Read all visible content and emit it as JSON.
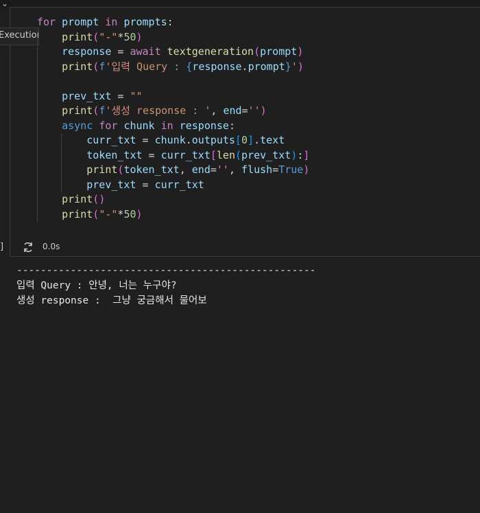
{
  "cell": {
    "exec_tab_label": "Execution",
    "code_lines": [
      [
        {
          "t": "for",
          "c": "ctl"
        },
        {
          "t": " "
        },
        {
          "t": "prompt",
          "c": "var"
        },
        {
          "t": " "
        },
        {
          "t": "in",
          "c": "ctl"
        },
        {
          "t": " "
        },
        {
          "t": "prompts",
          "c": "var"
        },
        {
          "t": ":"
        }
      ],
      [
        {
          "t": "    "
        },
        {
          "t": "print",
          "c": "fn"
        },
        {
          "t": "(",
          "c": "br2"
        },
        {
          "t": "\"-\"",
          "c": "str"
        },
        {
          "t": "*"
        },
        {
          "t": "50",
          "c": "num"
        },
        {
          "t": ")",
          "c": "br2"
        }
      ],
      [
        {
          "t": "    "
        },
        {
          "t": "response",
          "c": "var"
        },
        {
          "t": " = "
        },
        {
          "t": "await",
          "c": "ctl"
        },
        {
          "t": " "
        },
        {
          "t": "textgeneration",
          "c": "fn"
        },
        {
          "t": "(",
          "c": "br2"
        },
        {
          "t": "prompt",
          "c": "var"
        },
        {
          "t": ")",
          "c": "br2"
        }
      ],
      [
        {
          "t": "    "
        },
        {
          "t": "print",
          "c": "fn"
        },
        {
          "t": "(",
          "c": "br2"
        },
        {
          "t": "f",
          "c": "kw"
        },
        {
          "t": "'입력 Query : ",
          "c": "str"
        },
        {
          "t": "{",
          "c": "kw"
        },
        {
          "t": "response",
          "c": "var"
        },
        {
          "t": "."
        },
        {
          "t": "prompt",
          "c": "var"
        },
        {
          "t": "}",
          "c": "kw"
        },
        {
          "t": "'",
          "c": "str"
        },
        {
          "t": ")",
          "c": "br2"
        }
      ],
      [
        {
          "t": ""
        }
      ],
      [
        {
          "t": "    "
        },
        {
          "t": "prev_txt",
          "c": "var"
        },
        {
          "t": " = "
        },
        {
          "t": "\"\"",
          "c": "str"
        }
      ],
      [
        {
          "t": "    "
        },
        {
          "t": "print",
          "c": "fn"
        },
        {
          "t": "(",
          "c": "br2"
        },
        {
          "t": "f",
          "c": "kw"
        },
        {
          "t": "'생성 response : '",
          "c": "str"
        },
        {
          "t": ", "
        },
        {
          "t": "end",
          "c": "var"
        },
        {
          "t": "="
        },
        {
          "t": "''",
          "c": "str"
        },
        {
          "t": ")",
          "c": "br2"
        }
      ],
      [
        {
          "t": "    "
        },
        {
          "t": "async",
          "c": "kw"
        },
        {
          "t": " "
        },
        {
          "t": "for",
          "c": "ctl"
        },
        {
          "t": " "
        },
        {
          "t": "chunk",
          "c": "var"
        },
        {
          "t": " "
        },
        {
          "t": "in",
          "c": "ctl"
        },
        {
          "t": " "
        },
        {
          "t": "response",
          "c": "var"
        },
        {
          "t": ":"
        }
      ],
      [
        {
          "t": "        "
        },
        {
          "t": "curr_txt",
          "c": "var"
        },
        {
          "t": " = "
        },
        {
          "t": "chunk",
          "c": "var"
        },
        {
          "t": "."
        },
        {
          "t": "outputs",
          "c": "var"
        },
        {
          "t": "[",
          "c": "br3"
        },
        {
          "t": "0",
          "c": "num"
        },
        {
          "t": "]",
          "c": "br3"
        },
        {
          "t": "."
        },
        {
          "t": "text",
          "c": "var"
        }
      ],
      [
        {
          "t": "        "
        },
        {
          "t": "token_txt",
          "c": "var"
        },
        {
          "t": " = "
        },
        {
          "t": "curr_txt",
          "c": "var"
        },
        {
          "t": "[",
          "c": "br2"
        },
        {
          "t": "len",
          "c": "fn"
        },
        {
          "t": "(",
          "c": "br3"
        },
        {
          "t": "prev_txt",
          "c": "var"
        },
        {
          "t": ")",
          "c": "br3"
        },
        {
          "t": ":"
        },
        {
          "t": "]",
          "c": "br2"
        }
      ],
      [
        {
          "t": "        "
        },
        {
          "t": "print",
          "c": "fn"
        },
        {
          "t": "(",
          "c": "br2"
        },
        {
          "t": "token_txt",
          "c": "var"
        },
        {
          "t": ", "
        },
        {
          "t": "end",
          "c": "var"
        },
        {
          "t": "="
        },
        {
          "t": "''",
          "c": "str"
        },
        {
          "t": ", "
        },
        {
          "t": "flush",
          "c": "var"
        },
        {
          "t": "="
        },
        {
          "t": "True",
          "c": "kw"
        },
        {
          "t": ")",
          "c": "br2"
        }
      ],
      [
        {
          "t": "        "
        },
        {
          "t": "prev_txt",
          "c": "var"
        },
        {
          "t": " = "
        },
        {
          "t": "curr_txt",
          "c": "var"
        }
      ],
      [
        {
          "t": "    "
        },
        {
          "t": "print",
          "c": "fn"
        },
        {
          "t": "(",
          "c": "br2"
        },
        {
          "t": ")",
          "c": "br2"
        }
      ],
      [
        {
          "t": "    "
        },
        {
          "t": "print",
          "c": "fn"
        },
        {
          "t": "(",
          "c": "br2"
        },
        {
          "t": "\"-\"",
          "c": "str"
        },
        {
          "t": "*"
        },
        {
          "t": "50",
          "c": "num"
        },
        {
          "t": ")",
          "c": "br2"
        }
      ]
    ],
    "status": {
      "bracket": "]",
      "icon": "refresh-icon",
      "time": "0.0s"
    }
  },
  "output": {
    "lines": [
      "--------------------------------------------------",
      "입력 Query : 안녕, 너는 누구야?",
      "생성 response :  그냥 궁금해서 물어보"
    ]
  },
  "colors": {
    "background": "#1e1e1e",
    "keyword": "#569cd6",
    "control": "#c586c0",
    "variable": "#9cdcfe",
    "function": "#dcdcaa",
    "string": "#ce9178",
    "number": "#b5cea8"
  }
}
